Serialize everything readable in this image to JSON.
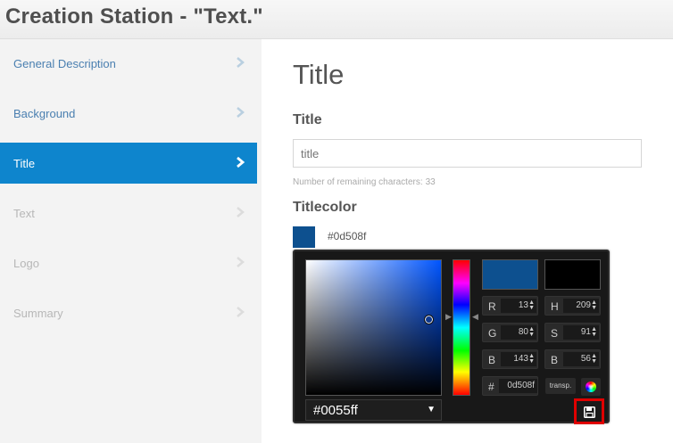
{
  "header": {
    "title": "Creation Station - \"Text.\""
  },
  "sidebar": {
    "items": [
      {
        "label": "General Description",
        "state": "normal"
      },
      {
        "label": "Background",
        "state": "normal"
      },
      {
        "label": "Title",
        "state": "active"
      },
      {
        "label": "Text",
        "state": "disabled"
      },
      {
        "label": "Logo",
        "state": "disabled"
      },
      {
        "label": "Summary",
        "state": "disabled"
      }
    ],
    "chevron_icon": "chevron-right-icon"
  },
  "main": {
    "page_title": "Title",
    "title_field": {
      "label": "Title",
      "placeholder": "title",
      "value": "",
      "remaining_text": "Number of remaining characters:",
      "remaining_count": "33"
    },
    "titlecolor": {
      "label": "Titlecolor",
      "hex": "#0d508f",
      "swatch_color": "#0d508f"
    }
  },
  "color_picker": {
    "new_color": "#0d508f",
    "old_color": "#000000",
    "hue_base": "#0055ff",
    "fields": {
      "r": {
        "label": "R",
        "value": "13"
      },
      "g": {
        "label": "G",
        "value": "80"
      },
      "b": {
        "label": "B",
        "value": "143"
      },
      "h": {
        "label": "H",
        "value": "209"
      },
      "s": {
        "label": "S",
        "value": "91"
      },
      "bv": {
        "label": "B",
        "value": "56"
      },
      "hex": {
        "label": "#",
        "value": "0d508f"
      }
    },
    "transp_label": "transp.",
    "wheel_icon": "color-wheel-icon",
    "preset_value": "#0055ff",
    "save_icon": "floppy-disk-icon",
    "highlight_color": "#e00000"
  },
  "colors": {
    "active_nav": "#0e85cd",
    "link": "#4a7fb0",
    "disabled": "#b7b7b7"
  }
}
